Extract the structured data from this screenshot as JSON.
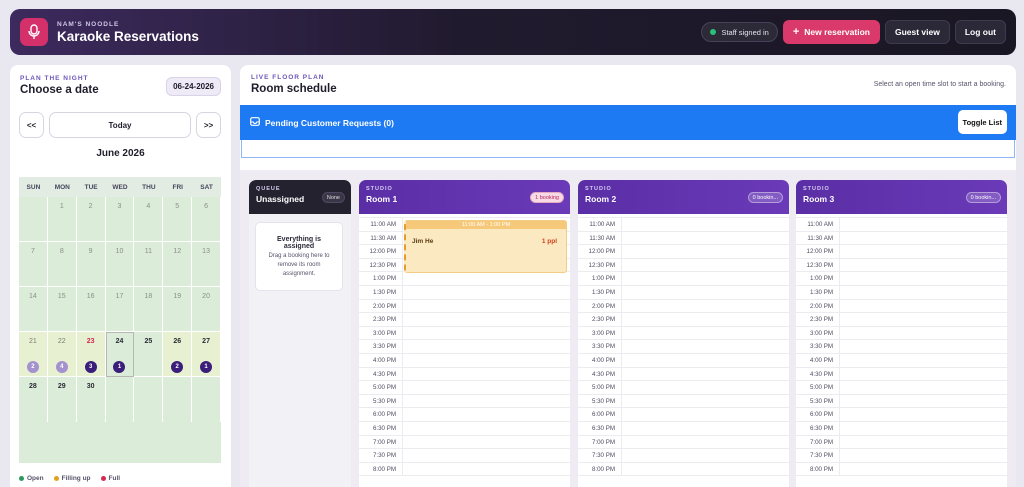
{
  "header": {
    "brand_sub": "NAM'S NOODLE",
    "title": "Karaoke Reservations",
    "staff_label": "Staff signed in",
    "new_reservation": "New reservation",
    "guest_view": "Guest view",
    "logout": "Log out"
  },
  "calendar": {
    "kicker": "PLAN THE NIGHT",
    "heading": "Choose a date",
    "selected_date": "06-24-2026",
    "prev": "<<",
    "today": "Today",
    "next": ">>",
    "month": "June 2026",
    "weekdays": [
      "SUN",
      "MON",
      "TUE",
      "WED",
      "THU",
      "FRI",
      "SAT"
    ],
    "days": [
      "",
      "1",
      "2",
      "3",
      "4",
      "5",
      "6",
      "7",
      "8",
      "9",
      "10",
      "11",
      "12",
      "13",
      "14",
      "15",
      "16",
      "17",
      "18",
      "19",
      "20",
      "21",
      "22",
      "23",
      "24",
      "25",
      "26",
      "27",
      "28",
      "29",
      "30"
    ],
    "counts": {
      "21": "2",
      "22": "4",
      "23": "3",
      "24": "1",
      "26": "2",
      "27": "1"
    },
    "legend": [
      "Open",
      "Filling up",
      "Full"
    ],
    "legend_colors": [
      "#2b9a5e",
      "#e0a21e",
      "#d42a4f"
    ]
  },
  "main": {
    "kicker": "LIVE FLOOR PLAN",
    "heading": "Room schedule",
    "hint": "Select an open time slot to start a booking.",
    "pending": "Pending Customer Requests (0)",
    "toggle": "Toggle List"
  },
  "queue": {
    "kicker": "QUEUE",
    "name": "Unassigned",
    "chip": "None",
    "card_title": "Everything is assigned",
    "card_body": "Drag a booking here to remove its room assignment."
  },
  "rooms": [
    {
      "kicker": "STUDIO",
      "name": "Room 1",
      "chip": "1 booking"
    },
    {
      "kicker": "STUDIO",
      "name": "Room 2",
      "chip": "0 bookin..."
    },
    {
      "kicker": "STUDIO",
      "name": "Room 3",
      "chip": "0 bookin..."
    }
  ],
  "times": [
    "11:00 AM",
    "11:30 AM",
    "12:00 PM",
    "12:30 PM",
    "1:00 PM",
    "1:30 PM",
    "2:00 PM",
    "2:30 PM",
    "3:00 PM",
    "3:30 PM",
    "4:00 PM",
    "4:30 PM",
    "5:00 PM",
    "5:30 PM",
    "6:00 PM",
    "6:30 PM",
    "7:00 PM",
    "7:30 PM",
    "8:00 PM"
  ],
  "booking": {
    "time": "11:00 AM - 1:00 PM",
    "name": "Jim He",
    "ppl": "1 ppl"
  }
}
